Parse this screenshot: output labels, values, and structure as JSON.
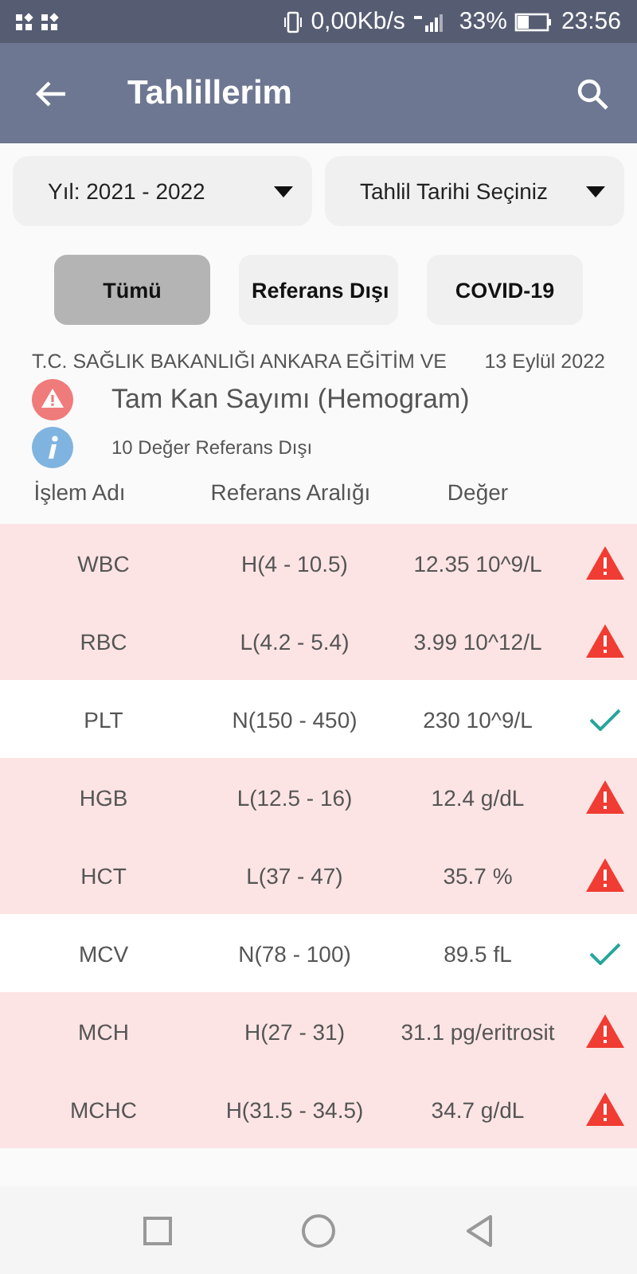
{
  "status_bar": {
    "speed": "0,00Kb/s",
    "battery": "33%",
    "time": "23:56"
  },
  "app_bar": {
    "title": "Tahlillerim"
  },
  "filters": [
    {
      "label": "Yıl: 2021 - 2022"
    },
    {
      "label": "Tahlil Tarihi Seçiniz"
    }
  ],
  "tabs": [
    {
      "label": "Tümü",
      "selected": true
    },
    {
      "label": "Referans Dışı",
      "selected": false
    },
    {
      "label": "COVID-19",
      "selected": false
    }
  ],
  "report": {
    "hospital": "T.C. SAĞLIK BAKANLIĞI ANKARA EĞİTİM VE",
    "date": "13 Eylül 2022",
    "test_name": "Tam Kan Sayımı (Hemogram)",
    "summary": "10 Değer Referans Dışı"
  },
  "table": {
    "columns": [
      "İşlem Adı",
      "Referans Aralığı",
      "Değer"
    ],
    "rows": [
      {
        "name": "WBC",
        "range": "H(4 - 10.5)",
        "value": "12.35 10^9/L",
        "out_of_range": true
      },
      {
        "name": "RBC",
        "range": "L(4.2 - 5.4)",
        "value": "3.99 10^12/L",
        "out_of_range": true
      },
      {
        "name": "PLT",
        "range": "N(150 - 450)",
        "value": "230 10^9/L",
        "out_of_range": false
      },
      {
        "name": "HGB",
        "range": "L(12.5 - 16)",
        "value": "12.4 g/dL",
        "out_of_range": true
      },
      {
        "name": "HCT",
        "range": "L(37 - 47)",
        "value": "35.7 %",
        "out_of_range": true
      },
      {
        "name": "MCV",
        "range": "N(78 - 100)",
        "value": "89.5 fL",
        "out_of_range": false
      },
      {
        "name": "MCH",
        "range": "H(27 - 31)",
        "value": "31.1 pg/eritrosit",
        "out_of_range": true
      },
      {
        "name": "MCHC",
        "range": "H(31.5 - 34.5)",
        "value": "34.7 g/dL",
        "out_of_range": true
      }
    ]
  }
}
